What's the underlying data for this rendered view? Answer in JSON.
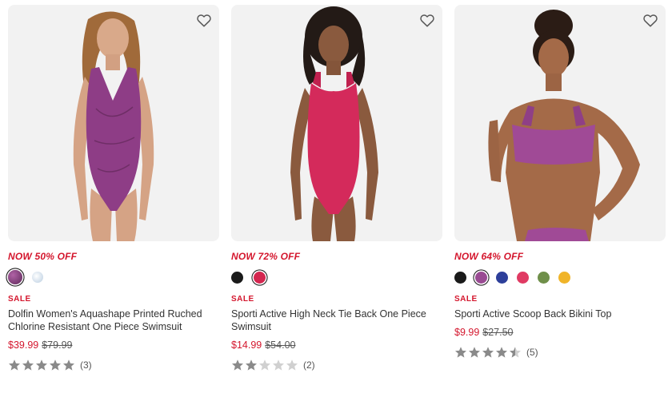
{
  "products": [
    {
      "promo": "NOW 50% OFF",
      "sale_label": "SALE",
      "title": "Dolfin Women's Aquashape Printed Ruched Chlorine Resistant One Piece Swimsuit",
      "price_now": "$39.99",
      "price_was": "$79.99",
      "rating_value": 5,
      "review_count": "(3)",
      "swatches": [
        {
          "color": "#7a3b73",
          "selected": true,
          "pattern": true
        },
        {
          "color": "#cfdbe8",
          "selected": false,
          "pattern": true
        }
      ],
      "suit_color": "#8e3d86",
      "favorite_icon": "heart-outline-icon"
    },
    {
      "promo": "NOW 72% OFF",
      "sale_label": "SALE",
      "title": "Sporti Active High Neck Tie Back One Piece Swimsuit",
      "price_now": "$14.99",
      "price_was": "$54.00",
      "rating_value": 2,
      "review_count": "(2)",
      "swatches": [
        {
          "color": "#1a1a1a",
          "selected": false
        },
        {
          "color": "#d4264f",
          "selected": true
        }
      ],
      "suit_color": "#d42a5b",
      "favorite_icon": "heart-outline-icon"
    },
    {
      "promo": "NOW 64% OFF",
      "sale_label": "SALE",
      "title": "Sporti Active Scoop Back Bikini Top",
      "price_now": "$9.99",
      "price_was": "$27.50",
      "rating_value": 4.5,
      "review_count": "(5)",
      "swatches": [
        {
          "color": "#1a1a1a",
          "selected": false
        },
        {
          "color": "#9a4b93",
          "selected": true
        },
        {
          "color": "#2d3f9a",
          "selected": false
        },
        {
          "color": "#e03a63",
          "selected": false
        },
        {
          "color": "#6f8f4a",
          "selected": false
        },
        {
          "color": "#f0b429",
          "selected": false
        }
      ],
      "suit_color": "#a04a96",
      "favorite_icon": "heart-outline-icon"
    }
  ],
  "colors": {
    "sale_red": "#d4162d",
    "star_filled": "#8a8a8a",
    "star_empty": "#d0d0d0"
  }
}
